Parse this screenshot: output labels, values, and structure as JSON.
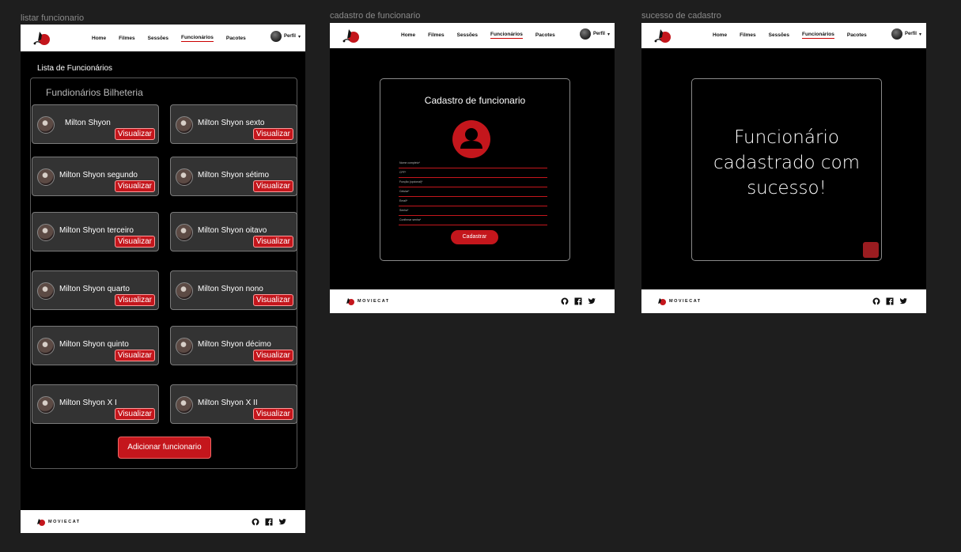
{
  "frames": {
    "list_label": "listar funcionario",
    "register_label": "cadastro de funcionario",
    "success_label": "sucesso de cadastro"
  },
  "nav": {
    "links": [
      "Home",
      "Filmes",
      "Sessões",
      "Funcionários",
      "Pacotes"
    ],
    "active": "Funcionários",
    "profile": "Perfil"
  },
  "footer": {
    "brand": "MOVIECAT",
    "icons": [
      "github-icon",
      "facebook-icon",
      "twitter-icon"
    ]
  },
  "list": {
    "title": "Lista de Funcionários",
    "section": "Fundionários Bilheteria",
    "view_label": "Visualizar",
    "employees": [
      "Milton Shyon",
      "Milton Shyon sexto",
      "Milton Shyon segundo",
      "Milton Shyon sétimo",
      "Milton Shyon terceiro",
      "Milton Shyon oitavo",
      "Milton Shyon quarto",
      "Milton Shyon nono",
      "Milton Shyon quinto",
      "Milton Shyon décimo",
      "Milton Shyon X I",
      "Milton Shyon X II"
    ],
    "add_button": "Adicionar funcionario"
  },
  "register": {
    "title": "Cadastro de funcionario",
    "fields": [
      "Nome completo*",
      "CPF*",
      "Função (opcional)*",
      "Celular*",
      "Email*",
      "Senha*",
      "Confirmar senha*"
    ],
    "submit": "Cadastrar"
  },
  "success": {
    "message_lines": [
      "Funcionário",
      "cadastrado com",
      "sucesso!"
    ]
  },
  "colors": {
    "accent": "#c4161c",
    "background": "#000000",
    "canvas": "#1e1e1e"
  }
}
